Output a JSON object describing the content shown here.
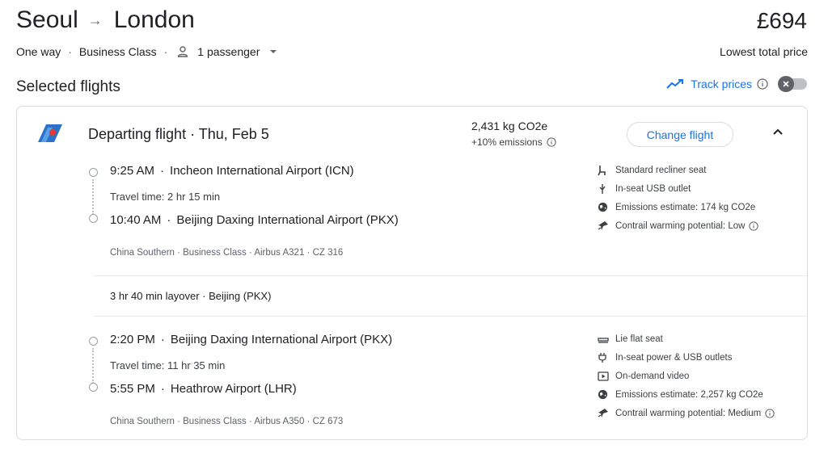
{
  "header": {
    "origin": "Seoul",
    "arrow": "→",
    "destination": "London",
    "price": "£694",
    "price_label": "Lowest total price",
    "trip_type": "One way",
    "cabin": "Business Class",
    "passengers": "1 passenger"
  },
  "section": {
    "title": "Selected flights",
    "track_label": "Track prices"
  },
  "departing": {
    "title": "Departing flight · Thu, Feb 5",
    "co2": "2,431 kg CO2e",
    "emissions": "+10% emissions",
    "change_button": "Change flight"
  },
  "legs": [
    {
      "dep_time": "9:25 AM",
      "dep_airport": "Incheon International Airport (ICN)",
      "travel_time": "Travel time: 2 hr 15 min",
      "arr_time": "10:40 AM",
      "arr_airport": "Beijing Daxing International Airport (PKX)",
      "details": "China Southern · Business Class · Airbus A321 · CZ 316",
      "amenities": [
        {
          "icon": "seat-icon",
          "label": "Standard recliner seat"
        },
        {
          "icon": "usb-icon",
          "label": "In-seat USB outlet"
        },
        {
          "icon": "globe-icon",
          "label": "Emissions estimate: 174 kg CO2e"
        },
        {
          "icon": "contrail-icon",
          "label": "Contrail warming potential: Low"
        }
      ]
    },
    {
      "dep_time": "2:20 PM",
      "dep_airport": "Beijing Daxing International Airport (PKX)",
      "travel_time": "Travel time: 11 hr 35 min",
      "arr_time": "5:55 PM",
      "arr_airport": "Heathrow Airport (LHR)",
      "details": "China Southern · Business Class · Airbus A350 · CZ 673",
      "amenities": [
        {
          "icon": "lie-flat-seat-icon",
          "label": "Lie flat seat"
        },
        {
          "icon": "power-plug-icon",
          "label": "In-seat power & USB outlets"
        },
        {
          "icon": "video-icon",
          "label": "On-demand video"
        },
        {
          "icon": "globe-icon",
          "label": "Emissions estimate: 2,257 kg CO2e"
        },
        {
          "icon": "contrail-icon",
          "label": "Contrail warming potential: Medium"
        }
      ]
    }
  ],
  "layover": "3 hr 40 min layover · Beijing (PKX)",
  "colors": {
    "accent": "#1a73e8",
    "text": "#202124",
    "secondary": "#5f6368",
    "border": "#dadce0"
  }
}
